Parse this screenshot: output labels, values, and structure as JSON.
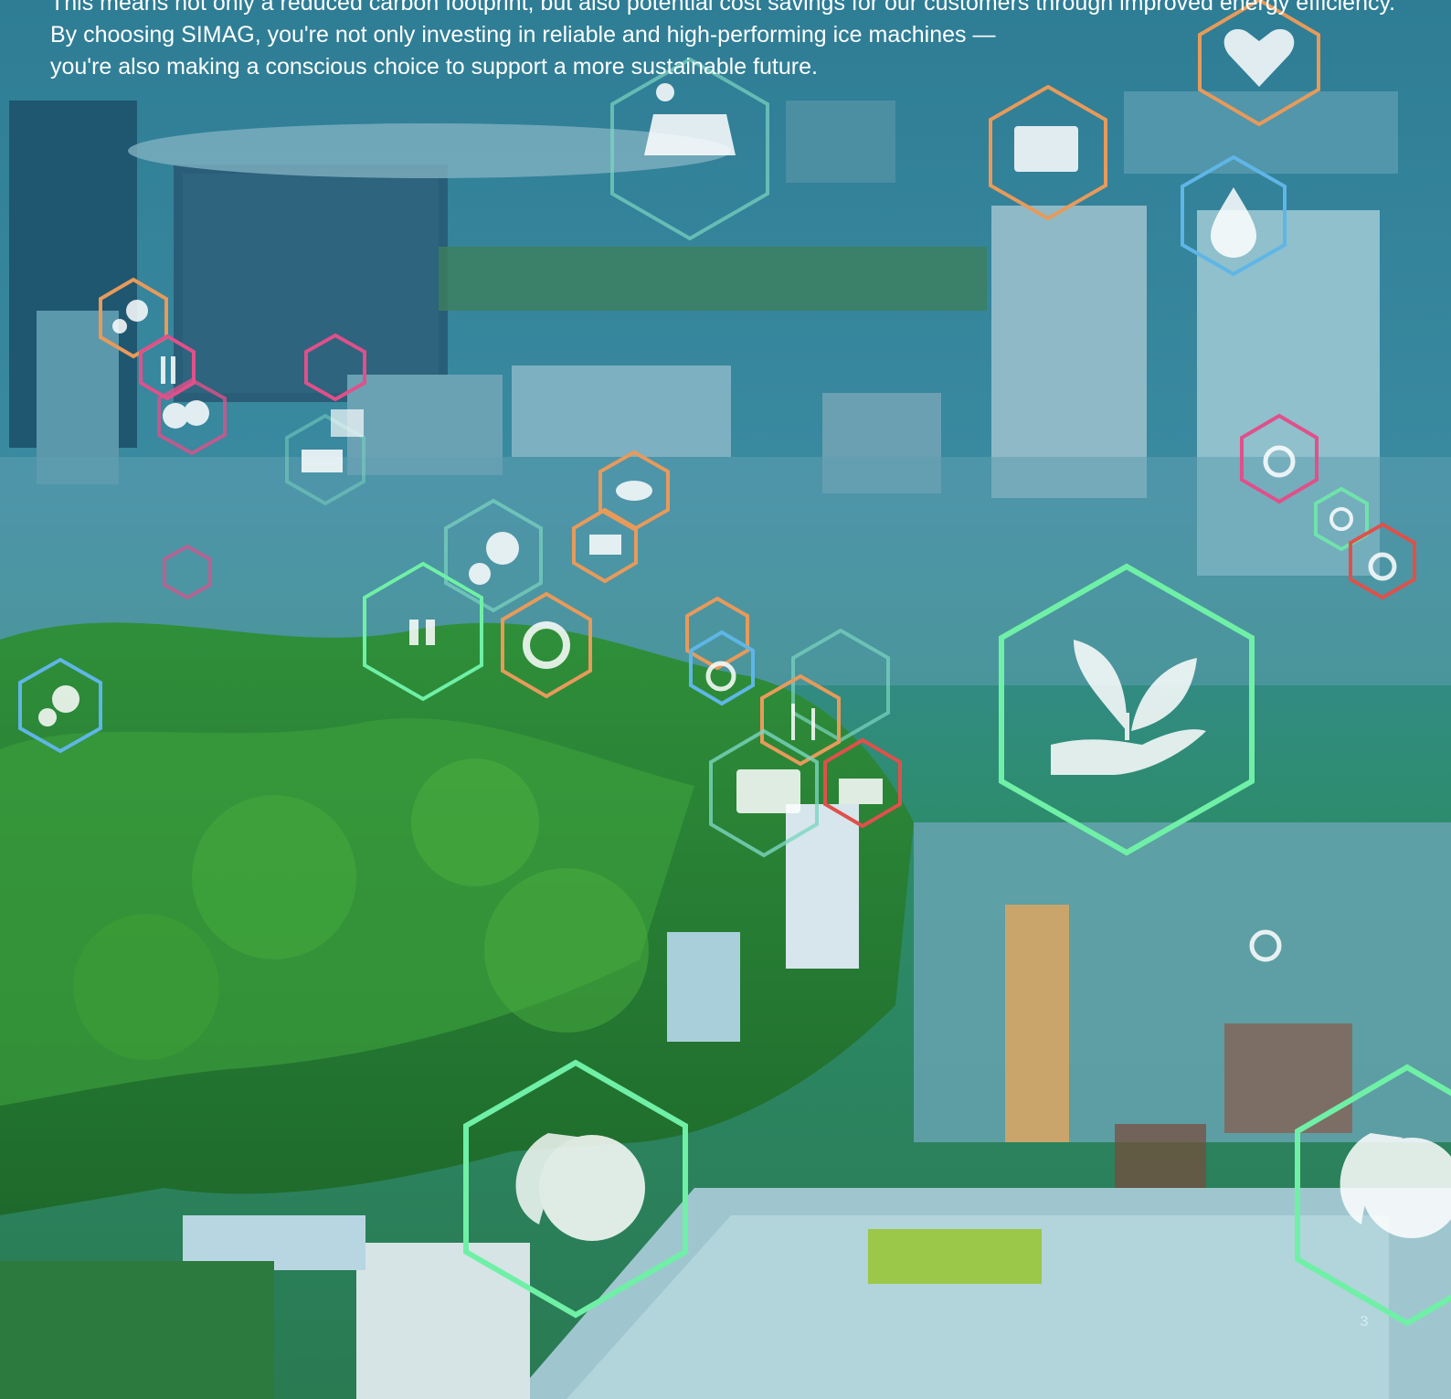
{
  "text": {
    "line1": "This means not only a reduced carbon footprint, but also potential cost savings for our customers through improved energy efficiency.",
    "line2": "By choosing SIMAG, you're not only investing in reliable and high-performing ice machines —",
    "line3": "you're also making a conscious choice to support a more sustainable future."
  },
  "page_number": "3",
  "icons": [
    "heart-rate-icon",
    "solar-panel-icon",
    "book-icon",
    "water-drop-icon",
    "gears-icon",
    "food-icon",
    "trees-icon",
    "growth-chart-icon",
    "wheelchair-icon",
    "recycle-icon",
    "handshake-icon",
    "factory-icon",
    "family-icon",
    "wind-turbine-icon",
    "plant-in-hand-icon",
    "eco-globe-icon"
  ],
  "colors": {
    "green_glow": "#6ff0a6",
    "orange": "#e89a5a",
    "pink": "#e0508a",
    "blue": "#5fb6e6",
    "red": "#e0504a"
  }
}
